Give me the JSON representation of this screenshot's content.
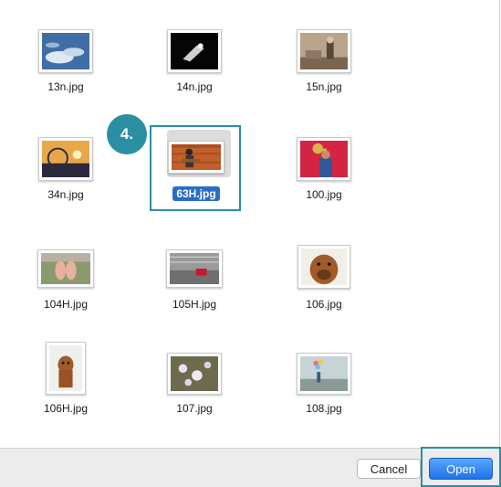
{
  "dialog": {
    "step_badge": "4.",
    "cancel_label": "Cancel",
    "open_label": "Open",
    "accent_color": "#2b8fa3",
    "selection_color": "#2a6dc5"
  },
  "files": [
    {
      "name": "13n.jpg",
      "selected": false
    },
    {
      "name": "14n.jpg",
      "selected": false
    },
    {
      "name": "15n.jpg",
      "selected": false
    },
    {
      "name": "34n.jpg",
      "selected": false
    },
    {
      "name": "63H.jpg",
      "selected": true
    },
    {
      "name": "100.jpg",
      "selected": false
    },
    {
      "name": "104H.jpg",
      "selected": false
    },
    {
      "name": "105H.jpg",
      "selected": false
    },
    {
      "name": "106.jpg",
      "selected": false
    },
    {
      "name": "106H.jpg",
      "selected": false
    },
    {
      "name": "107.jpg",
      "selected": false
    },
    {
      "name": "108.jpg",
      "selected": false
    }
  ]
}
